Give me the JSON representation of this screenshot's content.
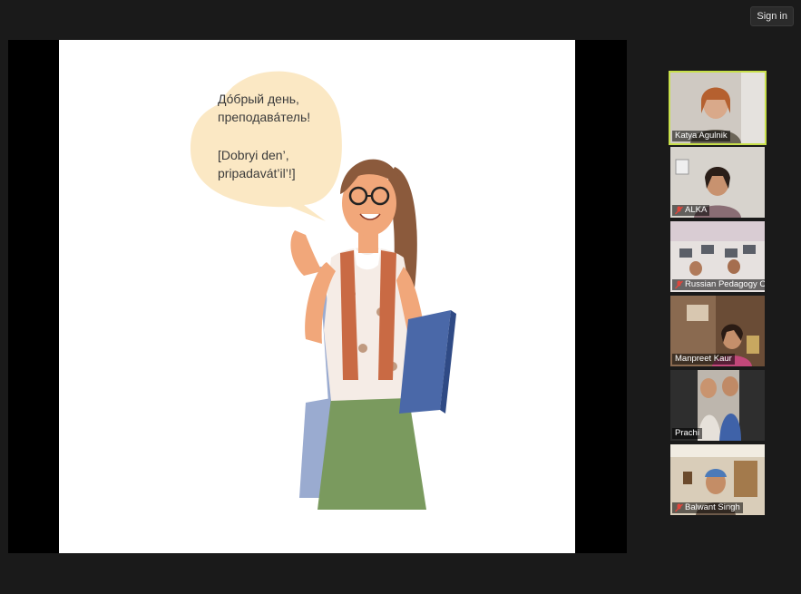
{
  "header": {
    "sign_in_label": "Sign in"
  },
  "slide": {
    "speech_line1": "До́брый день,",
    "speech_line2": "преподава́тель!",
    "speech_line3": "[Dobryi den’,",
    "speech_line4": "pripadavát’il’!]"
  },
  "participants": [
    {
      "name": "Katya Agulnik",
      "muted": false,
      "active": true
    },
    {
      "name": "ALKA",
      "muted": true,
      "active": false
    },
    {
      "name": "Russian Pedagogy Ce...",
      "muted": true,
      "active": false
    },
    {
      "name": "Manpreet Kaur",
      "muted": false,
      "active": false
    },
    {
      "name": "Prachi",
      "muted": false,
      "active": false
    },
    {
      "name": "Balwant Singh",
      "muted": true,
      "active": false
    }
  ],
  "colors": {
    "active_speaker_border": "#c8e04a",
    "muted_icon": "#e0463c",
    "bubble": "#fbe8c4",
    "skirt": "#7a9a5e",
    "scarf": "#c96a44"
  }
}
